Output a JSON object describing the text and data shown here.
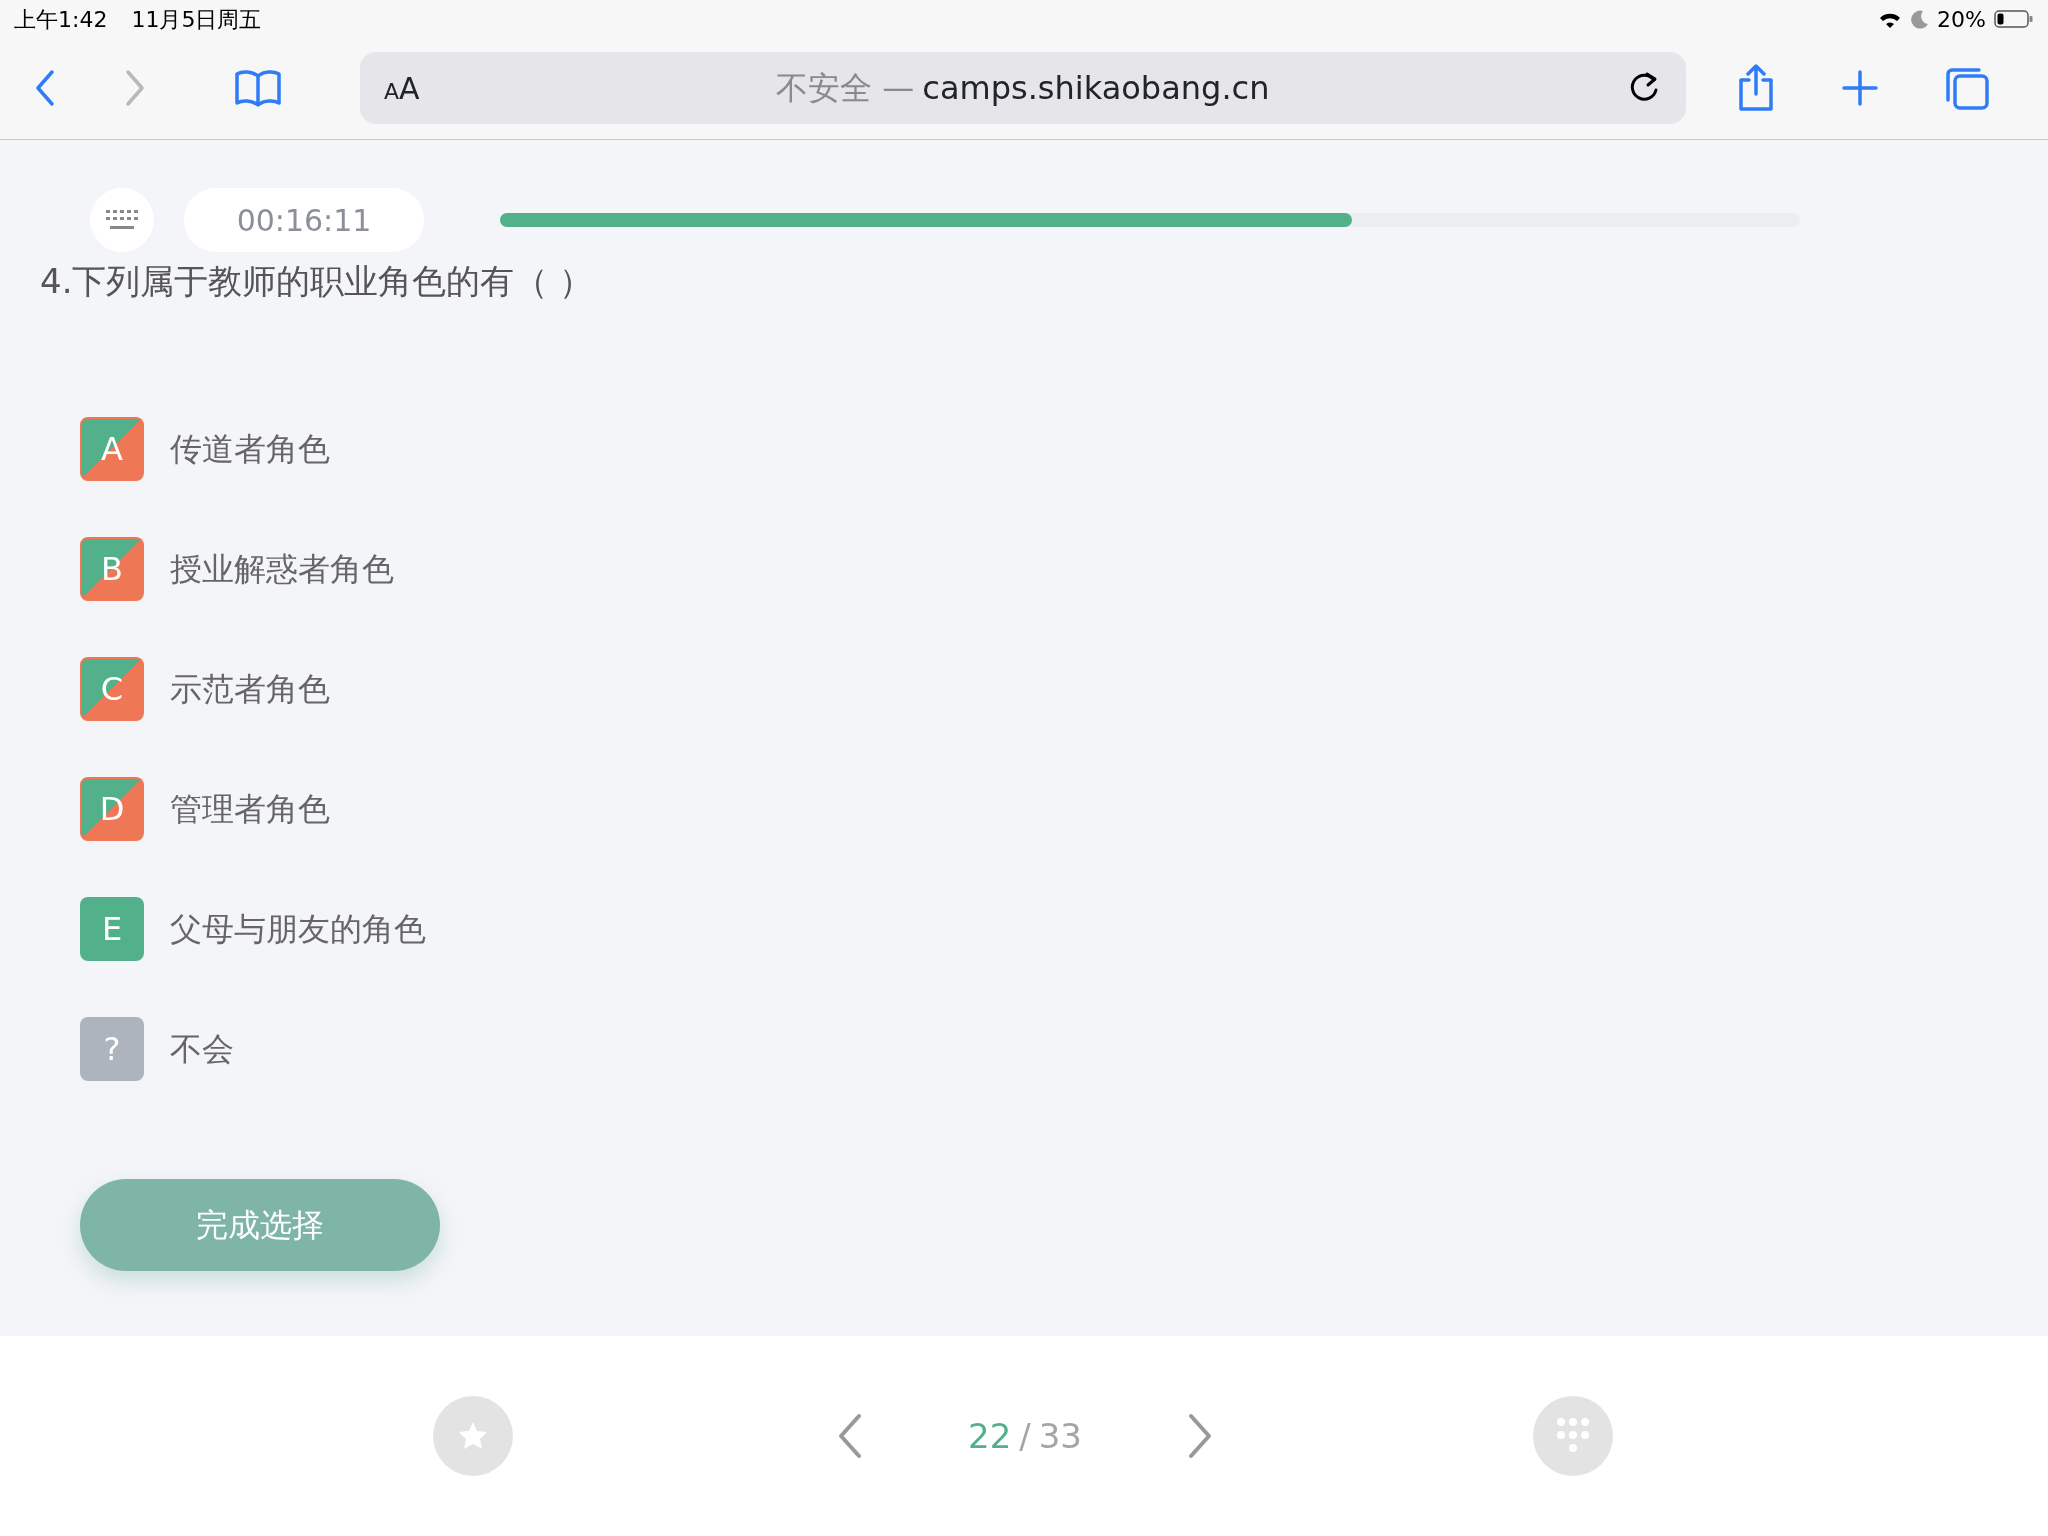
{
  "status_bar": {
    "time": "上午1:42",
    "date": "11月5日周五",
    "battery": "20%"
  },
  "browser": {
    "text_size_label": "AA",
    "security": "不安全 —",
    "host": "camps.shikaobang.cn",
    "forward_disabled": true
  },
  "quiz": {
    "timer": "00:16:11",
    "progress": {
      "level": 0.655
    },
    "question": "4.下列属于教师的职业角色的有（ ）",
    "options": [
      {
        "kind": "choice",
        "letter": "A",
        "text": "传道者角色",
        "selected": true
      },
      {
        "kind": "choice",
        "letter": "B",
        "text": "授业解惑者角色",
        "selected": true
      },
      {
        "kind": "choice",
        "letter": "C",
        "text": "示范者角色",
        "selected": true
      },
      {
        "kind": "choice",
        "letter": "D",
        "text": "管理者角色",
        "selected": true
      },
      {
        "kind": "choice",
        "letter": "E",
        "text": "父母与朋友的角色",
        "selected": false
      },
      {
        "kind": "unknown",
        "letter": "?",
        "text": "不会",
        "selected": false
      }
    ],
    "submit": "完成选择"
  },
  "pager": {
    "current": "22",
    "separator": "/",
    "total": "33"
  }
}
